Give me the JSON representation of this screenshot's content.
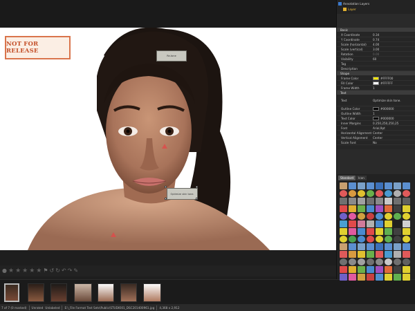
{
  "layers": {
    "items": [
      {
        "label": "Annotation Layers"
      },
      {
        "label": "Layer"
      }
    ]
  },
  "stamp": {
    "text": "NOT FOR RELEASE"
  },
  "notes": [
    {
      "text": "Re-tone"
    },
    {
      "text": "Optimize skin tone."
    }
  ],
  "properties": {
    "basic": {
      "title": "Basic",
      "rows": [
        {
          "key": "X Coordinate",
          "value": "0.34"
        },
        {
          "key": "Y Coordinate",
          "value": "0.74"
        },
        {
          "key": "Scale (horizontal)",
          "value": "4.00"
        },
        {
          "key": "Scale (vertical)",
          "value": "3.00"
        },
        {
          "key": "Rotation",
          "value": "0.00"
        },
        {
          "key": "Visibility",
          "value": "60"
        },
        {
          "key": "Tag",
          "value": ""
        },
        {
          "key": "Description",
          "value": ""
        }
      ]
    },
    "shape": {
      "title": "Shape",
      "rows": [
        {
          "key": "Frame Color",
          "value": "#FFFF00",
          "swatch": "#f2e400"
        },
        {
          "key": "Fill Color",
          "value": "#FFFFFF",
          "swatch": "#ffffff"
        },
        {
          "key": "Frame Width",
          "value": "1"
        }
      ]
    },
    "text": {
      "title": "Text",
      "rows": [
        {
          "key": "Text",
          "value": "Optimize skin tone."
        },
        {
          "key": "Outline Color",
          "value": "#000000",
          "swatch": "#000000"
        },
        {
          "key": "Outline Width",
          "value": "1"
        },
        {
          "key": "Text Color",
          "value": "#000000",
          "swatch": "#000000"
        },
        {
          "key": "Inner Margins",
          "value": "0.250,250,250,25"
        },
        {
          "key": "Font",
          "value": "Arial,9pt"
        },
        {
          "key": "Horizontal Alignment",
          "value": "Center"
        },
        {
          "key": "Vertical Alignment",
          "value": "Center"
        },
        {
          "key": "Scale Font",
          "value": "No"
        }
      ]
    }
  },
  "shape_tabs": [
    {
      "label": "Standard"
    },
    {
      "label": "Icon"
    }
  ],
  "status": {
    "count": "7 of 7 (0 marked)",
    "rating": "Unrated",
    "label": "Unlabeled",
    "path": "E:\\_File Format Test Sets\\Public\\STUDIO01_DSC201400961.jpg",
    "size": "4,368 x 2,912"
  },
  "colors": {
    "accent": "#f2e400",
    "stamp": "#c4502a",
    "panel": "#2a2a2a"
  }
}
